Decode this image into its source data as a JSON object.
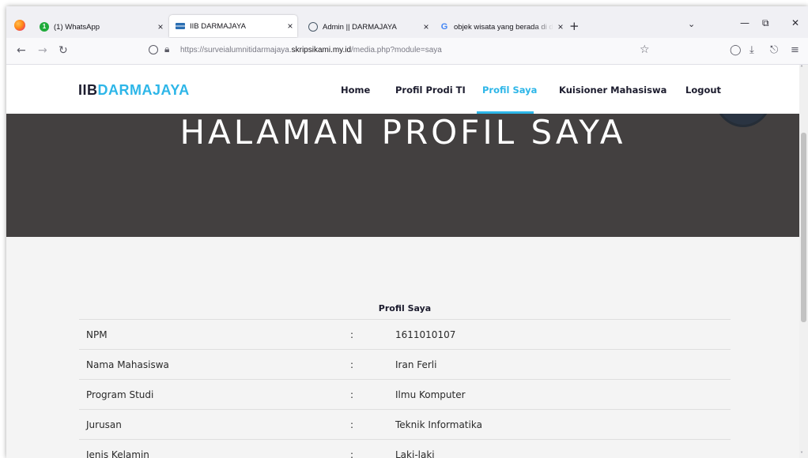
{
  "browser": {
    "tabs": [
      {
        "title": "(1) WhatsApp",
        "favicon": "whatsapp-icon",
        "badge": "1",
        "active": false
      },
      {
        "title": "IIB DARMAJAYA",
        "favicon": "iib-favicon-icon",
        "active": true
      },
      {
        "title": "Admin || DARMAJAYA",
        "favicon": "admin-globe-icon",
        "active": false
      },
      {
        "title": "objek wisata yang berada di dan",
        "favicon": "google-icon",
        "active": false
      }
    ],
    "new_tab_symbol": "+",
    "close_symbol": "×",
    "url_prefix": "https://surveialumnitidarmajaya.",
    "url_host": "skripsikami.my.id",
    "url_suffix": "/media.php?module=saya"
  },
  "site": {
    "logo_part1": "IIB",
    "logo_part2": "DARMAJAYA",
    "nav": [
      "Home",
      "Profil Prodi TI",
      "Profil Saya",
      "Kuisioner Mahasiswa",
      "Logout"
    ],
    "active_nav": "Profil Saya",
    "accent_color": "#2db6e8"
  },
  "hero": {
    "title": "HALAMAN PROFIL SAYA"
  },
  "profile": {
    "caption": "Profil Saya",
    "separator": ":",
    "rows": [
      {
        "label": "NPM",
        "value": "1611010107"
      },
      {
        "label": "Nama Mahasiswa",
        "value": "Iran Ferli"
      },
      {
        "label": "Program Studi",
        "value": "Ilmu Komputer"
      },
      {
        "label": "Jurusan",
        "value": "Teknik Informatika"
      },
      {
        "label": "Jenis Kelamin",
        "value": "Laki-laki"
      }
    ]
  }
}
